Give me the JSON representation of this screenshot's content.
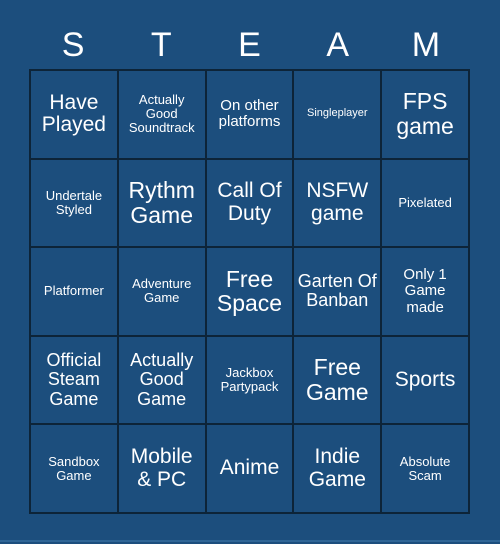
{
  "card": {
    "header_letters": [
      "S",
      "T",
      "E",
      "A",
      "M"
    ],
    "background_color": "#1c4e7d",
    "border_color": "#0d2438",
    "text_color": "#ffffff",
    "accent_color": "#2f6596",
    "columns": 5,
    "rows": 5,
    "cells": [
      {
        "text": "Have Played",
        "size": "fs-lg"
      },
      {
        "text": "Actually Good Soundtrack",
        "size": "fs-xs"
      },
      {
        "text": "On other platforms",
        "size": "fs-sm"
      },
      {
        "text": "Singleplayer",
        "size": "fs-xxs"
      },
      {
        "text": "FPS game",
        "size": "fs-xl"
      },
      {
        "text": "Undertale Styled",
        "size": "fs-xs"
      },
      {
        "text": "Rythm Game",
        "size": "fs-xl"
      },
      {
        "text": "Call Of Duty",
        "size": "fs-lg"
      },
      {
        "text": "NSFW game",
        "size": "fs-lg"
      },
      {
        "text": "Pixelated",
        "size": "fs-xs"
      },
      {
        "text": "Platformer",
        "size": "fs-xs"
      },
      {
        "text": "Adventure Game",
        "size": "fs-xs"
      },
      {
        "text": "Free Space",
        "size": "fs-xl"
      },
      {
        "text": "Garten Of Banban",
        "size": "fs-md"
      },
      {
        "text": "Only 1 Game made",
        "size": "fs-sm"
      },
      {
        "text": "Official Steam Game",
        "size": "fs-md"
      },
      {
        "text": "Actually Good Game",
        "size": "fs-md"
      },
      {
        "text": "Jackbox Partypack",
        "size": "fs-xs"
      },
      {
        "text": "Free Game",
        "size": "fs-xl"
      },
      {
        "text": "Sports",
        "size": "fs-lg"
      },
      {
        "text": "Sandbox Game",
        "size": "fs-xs"
      },
      {
        "text": "Mobile & PC",
        "size": "fs-lg"
      },
      {
        "text": "Anime",
        "size": "fs-lg"
      },
      {
        "text": "Indie Game",
        "size": "fs-lg"
      },
      {
        "text": "Absolute Scam",
        "size": "fs-xs"
      }
    ]
  }
}
